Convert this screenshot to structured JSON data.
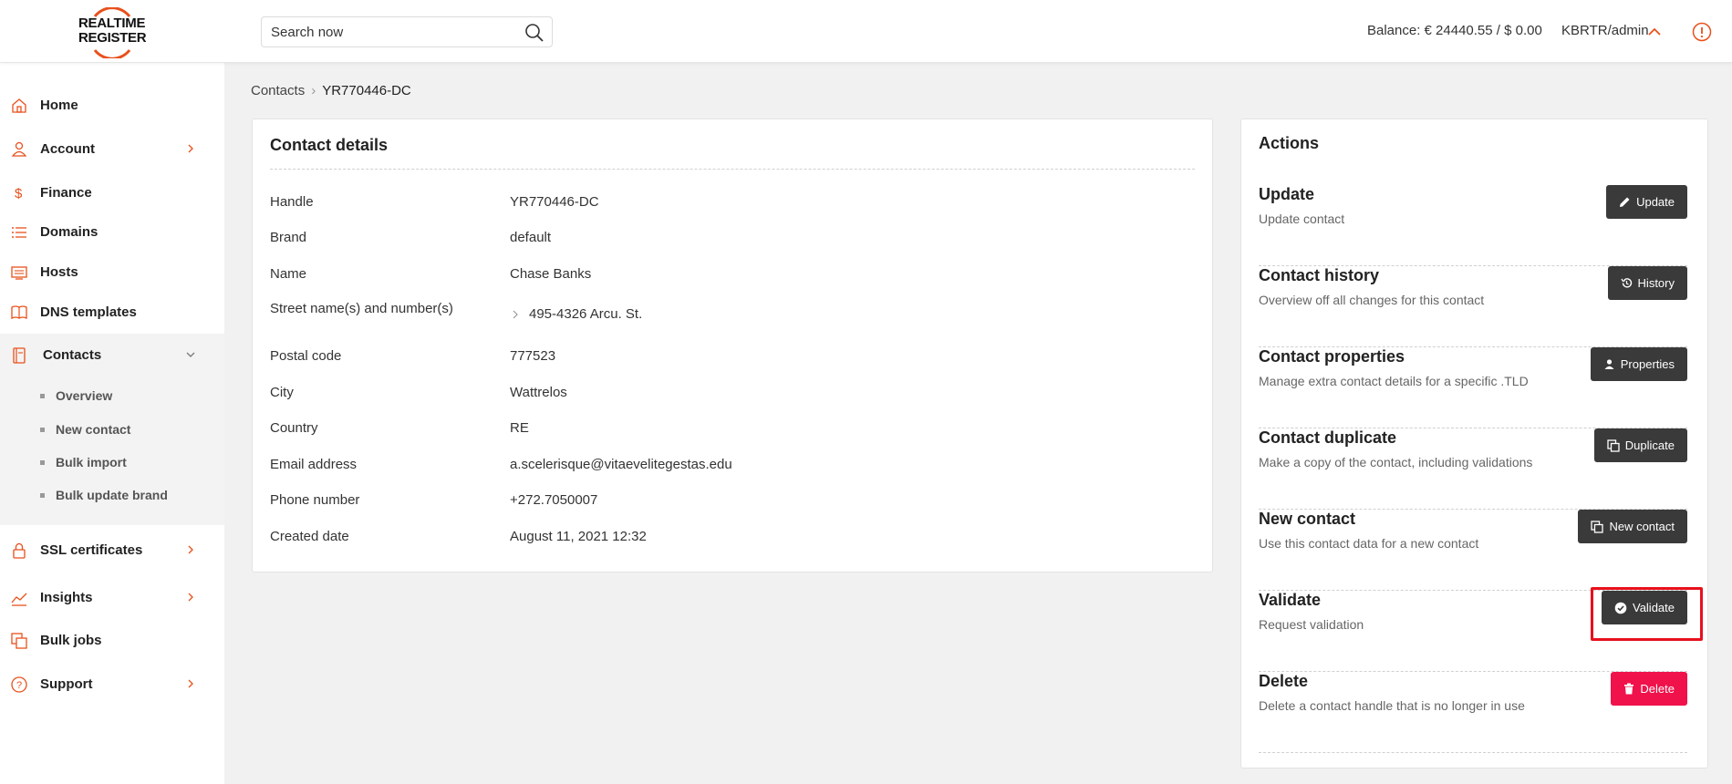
{
  "header": {
    "logo_line1": "REALTIME",
    "logo_line2": "REGISTER",
    "search_placeholder": "Search now",
    "balance": "Balance: € 24440.55 / $ 0.00",
    "user": "KBRTR/admin"
  },
  "sidebar": {
    "items": [
      {
        "label": "Home",
        "icon": "home-icon"
      },
      {
        "label": "Account",
        "icon": "user-icon"
      },
      {
        "label": "Finance",
        "icon": "dollar-icon"
      },
      {
        "label": "Domains",
        "icon": "list-icon"
      },
      {
        "label": "Hosts",
        "icon": "server-icon"
      },
      {
        "label": "DNS templates",
        "icon": "book-icon"
      },
      {
        "label": "Contacts",
        "icon": "contacts-icon"
      },
      {
        "label": "SSL certificates",
        "icon": "lock-icon"
      },
      {
        "label": "Insights",
        "icon": "chart-icon"
      },
      {
        "label": "Bulk jobs",
        "icon": "copy-icon"
      },
      {
        "label": "Support",
        "icon": "help-icon"
      }
    ],
    "contacts_sub": [
      "Overview",
      "New contact",
      "Bulk import",
      "Bulk update brand"
    ]
  },
  "breadcrumb": {
    "parent": "Contacts",
    "current": "YR770446-DC"
  },
  "details": {
    "title": "Contact details",
    "rows": [
      {
        "label": "Handle",
        "value": "YR770446-DC"
      },
      {
        "label": "Brand",
        "value": "default"
      },
      {
        "label": "Name",
        "value": "Chase Banks"
      },
      {
        "label": "Street name(s) and number(s)",
        "value": "495-4326 Arcu. St."
      },
      {
        "label": "Postal code",
        "value": "777523"
      },
      {
        "label": "City",
        "value": "Wattrelos"
      },
      {
        "label": "Country",
        "value": "RE"
      },
      {
        "label": "Email address",
        "value": "a.scelerisque@vitaevelitegestas.edu"
      },
      {
        "label": "Phone number",
        "value": "+272.7050007"
      },
      {
        "label": "Created date",
        "value": "August 11, 2021 12:32"
      }
    ]
  },
  "actions": {
    "title": "Actions",
    "items": [
      {
        "name": "Update",
        "desc": "Update contact",
        "button": "Update",
        "icon": "pencil-icon"
      },
      {
        "name": "Contact history",
        "desc": "Overview off all changes for this contact",
        "button": "History",
        "icon": "history-icon"
      },
      {
        "name": "Contact properties",
        "desc": "Manage extra contact details for a specific .TLD",
        "button": "Properties",
        "icon": "person-icon"
      },
      {
        "name": "Contact duplicate",
        "desc": "Make a copy of the contact, including validations",
        "button": "Duplicate",
        "icon": "duplicate-icon"
      },
      {
        "name": "New contact",
        "desc": "Use this contact data for a new contact",
        "button": "New contact",
        "icon": "copy-icon"
      },
      {
        "name": "Validate",
        "desc": "Request validation",
        "button": "Validate",
        "icon": "check-circle-icon"
      },
      {
        "name": "Delete",
        "desc": "Delete a contact handle that is no longer in use",
        "button": "Delete",
        "icon": "trash-icon"
      }
    ]
  },
  "colors": {
    "accent": "#e8501c",
    "button_dark": "#3a3a3a",
    "button_danger": "#f0124b",
    "highlight": "#e8101d"
  }
}
